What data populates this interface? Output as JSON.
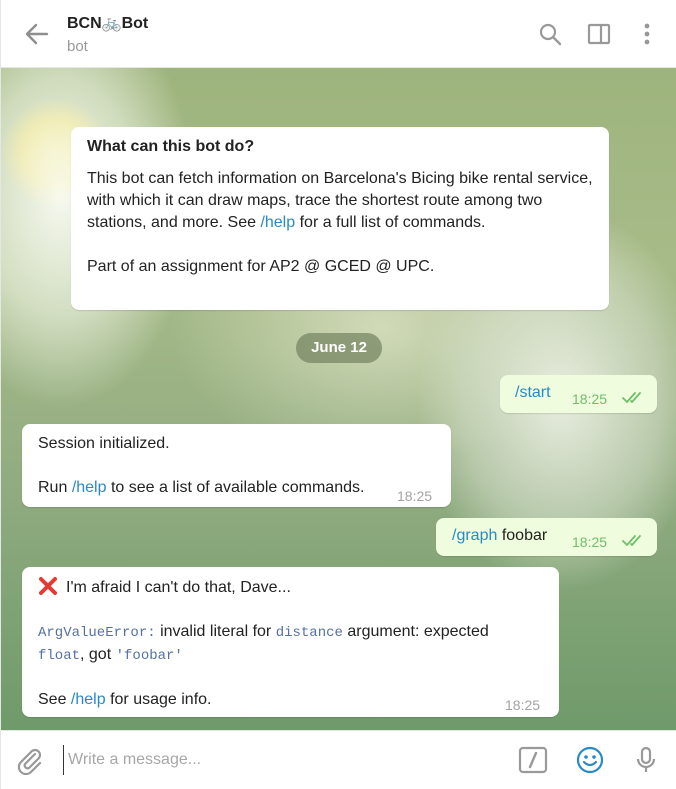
{
  "header": {
    "title": "BCN🚲Bot",
    "subtitle": "bot"
  },
  "intro": {
    "heading": "What can this bot do?",
    "text1": "This bot can fetch information on Barcelona's Bicing bike rental service, with which it can draw maps, trace the shortest route among two stations, and more. See",
    "link": "/help",
    "text2": "for a full list of commands.",
    "text3": "Part of an assignment for AP2 @ GCED @ UPC."
  },
  "date_separator": "June 12",
  "messages": {
    "m1": {
      "command": "/start",
      "time": "18:25"
    },
    "m2": {
      "line1": "Session initialized.",
      "run": "Run",
      "link": "/help",
      "rest": "to see a list of available commands.",
      "time": "18:25"
    },
    "m3": {
      "command": "/graph",
      "arg": "foobar",
      "time": "18:25"
    },
    "m4": {
      "line1": "I'm afraid I can't do that, Dave...",
      "err_name": "ArgValueError:",
      "err_t1": "invalid literal for",
      "err_code1": "distance",
      "err_t2": "argument: expected",
      "err_code2": "float",
      "err_t3": ", got",
      "err_code3": "'foobar'",
      "see": "See",
      "link": "/help",
      "rest": "for usage info.",
      "time": "18:25"
    }
  },
  "composer": {
    "placeholder": "Write a message..."
  },
  "colors": {
    "accent": "#2a8ac4",
    "outgoing_bubble": "#effdde",
    "check": "#6fbe6a",
    "error_x": "#e53935"
  },
  "icons": [
    "back-arrow-icon",
    "search-icon",
    "sidebar-toggle-icon",
    "more-vertical-icon",
    "paperclip-icon",
    "bot-commands-icon",
    "emoji-icon",
    "microphone-icon",
    "double-check-icon",
    "red-cross-icon"
  ]
}
